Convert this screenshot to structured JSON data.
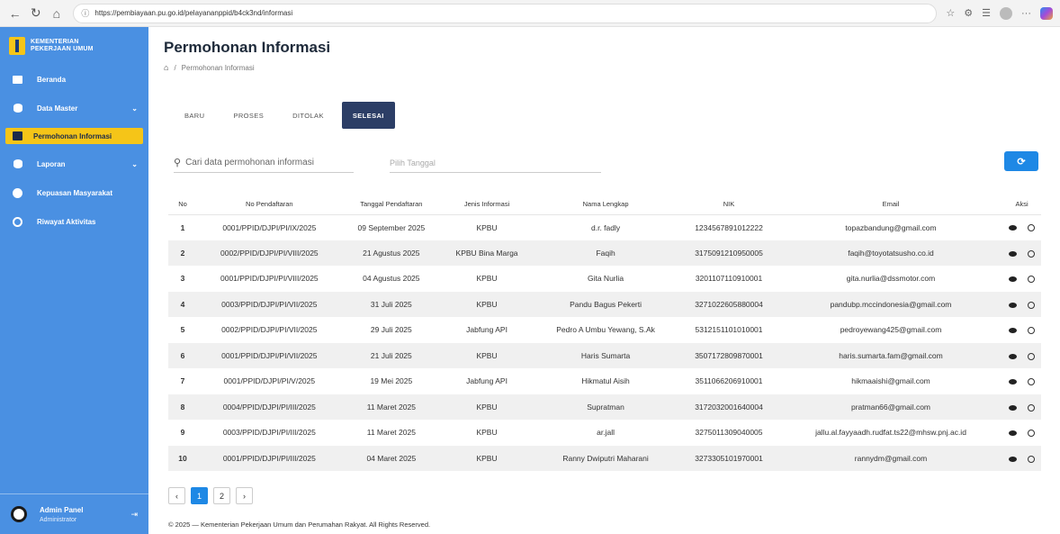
{
  "browser": {
    "url": "https://pembiayaan.pu.go.id/pelayananppid/b4ck3nd/informasi"
  },
  "sidebar": {
    "brand_line1": "KEMENTERIAN",
    "brand_line2": "PEKERJAAN UMUM",
    "items": [
      {
        "label": "Beranda"
      },
      {
        "label": "Data Master"
      },
      {
        "label": "Permohonan Informasi"
      },
      {
        "label": "Laporan"
      },
      {
        "label": "Kepuasan Masyarakat"
      },
      {
        "label": "Riwayat Aktivitas"
      }
    ],
    "admin_name": "Admin Panel",
    "admin_role": "Administrator"
  },
  "page": {
    "title": "Permohonan Informasi",
    "breadcrumb_sep": "/",
    "breadcrumb": "Permohonan Informasi"
  },
  "tabs": [
    {
      "label": "BARU"
    },
    {
      "label": "PROSES"
    },
    {
      "label": "DITOLAK"
    },
    {
      "label": "SELESAI"
    }
  ],
  "search": {
    "placeholder": "Cari data permohonan informasi",
    "date_placeholder": "Pilih Tanggal"
  },
  "table": {
    "headers": [
      "No",
      "No Pendaftaran",
      "Tanggal Pendaftaran",
      "Jenis Informasi",
      "Nama Lengkap",
      "NIK",
      "Email",
      "Aksi"
    ],
    "rows": [
      {
        "no": "1",
        "reg": "0001/PPID/DJPI/PI/IX/2025",
        "date": "09 September 2025",
        "type": "KPBU",
        "name": "d.r. fadly",
        "nik": "1234567891012222",
        "email": "topazbandung@gmail.com"
      },
      {
        "no": "2",
        "reg": "0002/PPID/DJPI/PI/VIII/2025",
        "date": "21 Agustus 2025",
        "type": "KPBU Bina Marga",
        "name": "Faqih",
        "nik": "3175091210950005",
        "email": "faqih@toyotatsusho.co.id"
      },
      {
        "no": "3",
        "reg": "0001/PPID/DJPI/PI/VIII/2025",
        "date": "04 Agustus 2025",
        "type": "KPBU",
        "name": "Gita Nurlia",
        "nik": "3201107110910001",
        "email": "gita.nurlia@dssmotor.com"
      },
      {
        "no": "4",
        "reg": "0003/PPID/DJPI/PI/VII/2025",
        "date": "31 Juli 2025",
        "type": "KPBU",
        "name": "Pandu Bagus Pekerti",
        "nik": "3271022605880004",
        "email": "pandubp.mccindonesia@gmail.com"
      },
      {
        "no": "5",
        "reg": "0002/PPID/DJPI/PI/VII/2025",
        "date": "29 Juli 2025",
        "type": "Jabfung API",
        "name": "Pedro A Umbu Yewang, S.Ak",
        "nik": "5312151101010001",
        "email": "pedroyewang425@gmail.com"
      },
      {
        "no": "6",
        "reg": "0001/PPID/DJPI/PI/VII/2025",
        "date": "21 Juli 2025",
        "type": "KPBU",
        "name": "Haris Sumarta",
        "nik": "3507172809870001",
        "email": "haris.sumarta.fam@gmail.com"
      },
      {
        "no": "7",
        "reg": "0001/PPID/DJPI/PI/V/2025",
        "date": "19 Mei 2025",
        "type": "Jabfung API",
        "name": "Hikmatul Aisih",
        "nik": "3511066206910001",
        "email": "hikmaaishi@gmail.com"
      },
      {
        "no": "8",
        "reg": "0004/PPID/DJPI/PI/III/2025",
        "date": "11 Maret 2025",
        "type": "KPBU",
        "name": "Supratman",
        "nik": "3172032001640004",
        "email": "pratman66@gmail.com"
      },
      {
        "no": "9",
        "reg": "0003/PPID/DJPI/PI/III/2025",
        "date": "11 Maret 2025",
        "type": "KPBU",
        "name": "ar.jall",
        "nik": "3275011309040005",
        "email": "jallu.al.fayyaadh.rudfat.ts22@mhsw.pnj.ac.id"
      },
      {
        "no": "10",
        "reg": "0001/PPID/DJPI/PI/III/2025",
        "date": "04 Maret 2025",
        "type": "KPBU",
        "name": "Ranny Dwiputri Maharani",
        "nik": "3273305101970001",
        "email": "rannydm@gmail.com"
      }
    ]
  },
  "pagination": {
    "prev": "‹",
    "pages": [
      "1",
      "2"
    ],
    "next": "›"
  },
  "footer": {
    "text": "© 2025 — Kementerian Pekerjaan Umum dan Perumahan Rakyat. All Rights Reserved."
  },
  "colors": {
    "sidebar": "#4a90e2",
    "active_item": "#f5c518",
    "tab_active": "#2c3e66",
    "primary": "#1e88e5"
  }
}
